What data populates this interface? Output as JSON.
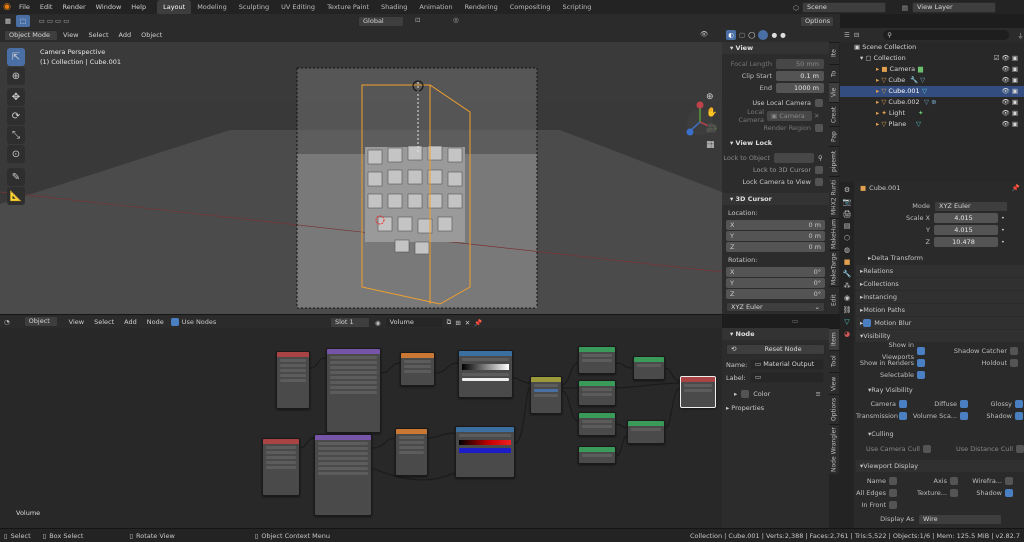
{
  "topbar": {
    "menus": [
      "File",
      "Edit",
      "Render",
      "Window",
      "Help"
    ],
    "workspaces": [
      "Layout",
      "Modeling",
      "Sculpting",
      "UV Editing",
      "Texture Paint",
      "Shading",
      "Animation",
      "Rendering",
      "Compositing",
      "Scripting"
    ],
    "active_workspace": "Layout",
    "scene": "Scene",
    "view_layer": "View Layer"
  },
  "viewport": {
    "mode": "Object Mode",
    "menus": [
      "View",
      "Select",
      "Add",
      "Object"
    ],
    "transform_orientation": "Global",
    "options_label": "Options",
    "overlay_line1": "Camera Perspective",
    "overlay_line2": "(1) Collection | Cube.001"
  },
  "npanel": {
    "view_title": "View",
    "focal_length_label": "Focal Length",
    "focal_length": "50 mm",
    "clip_start_label": "Clip Start",
    "clip_start": "0.1 m",
    "end_label": "End",
    "clip_end": "1000 m",
    "use_local_camera": "Use Local Camera",
    "local_camera_label": "Local Camera",
    "local_camera_value": "Camera",
    "render_region": "Render Region",
    "view_lock_title": "View Lock",
    "lock_to_object": "Lock to Object",
    "lock_to_3d_cursor": "Lock to 3D Cursor",
    "lock_camera_to_view": "Lock Camera to View",
    "cursor_title": "3D Cursor",
    "location_label": "Location:",
    "rotation_label": "Rotation:",
    "axes": [
      "X",
      "Y",
      "Z"
    ],
    "loc": [
      "0 m",
      "0 m",
      "0 m"
    ],
    "rot": [
      "0°",
      "0°",
      "0°"
    ],
    "rotation_mode": "XYZ Euler",
    "tabs": [
      "Ite",
      "To",
      "Vie",
      "Creat",
      "Pap",
      "pipemt",
      "MHX2 Runti",
      "MakeHum",
      "MakeTarge",
      "Edit"
    ]
  },
  "outliner": {
    "scene_collection": "Scene Collection",
    "collection": "Collection",
    "items": [
      "Camera",
      "Cube",
      "Cube.001",
      "Cube.002",
      "Light",
      "Plane"
    ],
    "selected": "Cube.001"
  },
  "properties": {
    "object_name": "Cube.001",
    "mode_label": "Mode",
    "mode_value": "XYZ Euler",
    "scale_label": "Scale X",
    "scale_axes": [
      "Scale X",
      "Y",
      "Z"
    ],
    "scale": [
      "4.015",
      "4.015",
      "10.478"
    ],
    "sections": [
      "Delta Transform",
      "Relations",
      "Collections",
      "Instancing",
      "Motion Paths",
      "Motion Blur",
      "Visibility"
    ],
    "vis_in_viewports": "Show in Viewports",
    "vis_in_renders": "Show in Renders",
    "selectable": "Selectable",
    "shadow_catcher": "Shadow Catcher",
    "holdout": "Holdout",
    "ray_visibility": "Ray Visibility",
    "ray_camera": "Camera",
    "ray_diffuse": "Diffuse",
    "ray_glossy": "Glossy",
    "ray_transmission": "Transmission",
    "ray_volume": "Volume Sca...",
    "ray_shadow": "Shadow",
    "culling": "Culling",
    "use_camera_cull": "Use Camera Cull",
    "use_distance_cull": "Use Distance Cull",
    "viewport_display": "Viewport Display",
    "vd_name": "Name",
    "vd_axis": "Axis",
    "vd_wireframe": "Wirefra...",
    "vd_all_edges": "All Edges",
    "vd_texture": "Texture...",
    "vd_shadow": "Shadow",
    "vd_in_front": "In Front",
    "display_as_label": "Display As",
    "display_as_value": "Wire"
  },
  "nodeeditor": {
    "editor_type": "Object",
    "menus": [
      "View",
      "Select",
      "Add",
      "Node"
    ],
    "use_nodes": "Use Nodes",
    "slot": "Slot 1",
    "material": "Volume",
    "corner_label": "Volume",
    "side_title": "Node",
    "reset_node": "Reset Node",
    "name_label": "Name:",
    "name_value": "Material Output",
    "label_label": "Label:",
    "color_label": "Color",
    "properties_label": "Properties",
    "tabs": [
      "Item",
      "Tool",
      "View",
      "Options",
      "Node Wrangler"
    ]
  },
  "statusbar": {
    "select": "Select",
    "box_select": "Box Select",
    "rotate_view": "Rotate View",
    "context_menu": "Object Context Menu",
    "stats": "Collection | Cube.001 | Verts:2,388 | Faces:2,761 | Tris:5,522 | Objects:1/6 | Mem: 125.5 MiB | v2.82.7"
  }
}
